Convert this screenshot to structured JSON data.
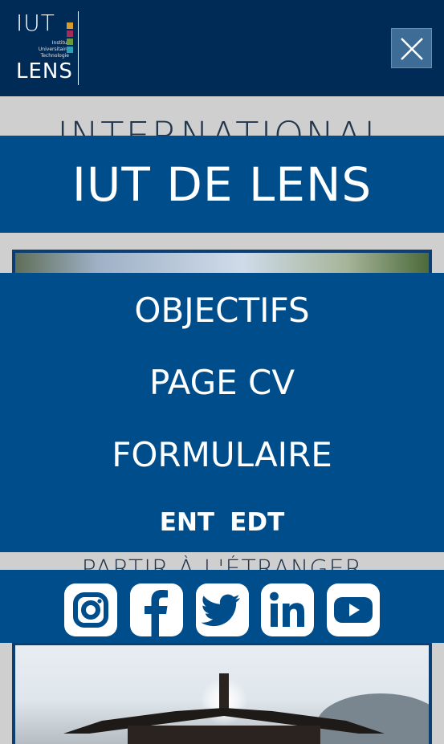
{
  "header": {
    "logo": {
      "top_text": "IUT",
      "bottom_text": "LENS",
      "subtitle_lines": [
        "Institut",
        "Universitaire",
        "Technologie"
      ],
      "square_colors": [
        "#d79d2c",
        "#a72a5a",
        "#6c9a3b",
        "#2a9fb6"
      ]
    },
    "close_icon": "close-icon"
  },
  "background": {
    "heading_top": "INTERNATIONAL",
    "heading_mid": "PARTIR À L'ÉTRANGER"
  },
  "menu": {
    "title": "IUT DE LENS",
    "items": [
      {
        "label": "OBJECTIFS"
      },
      {
        "label": "PAGE CV"
      },
      {
        "label": "FORMULAIRE"
      }
    ],
    "sub_links": [
      {
        "label": "ENT"
      },
      {
        "label": "EDT"
      }
    ]
  },
  "social": [
    {
      "icon": "instagram-icon"
    },
    {
      "icon": "facebook-icon"
    },
    {
      "icon": "twitter-icon"
    },
    {
      "icon": "linkedin-icon"
    },
    {
      "icon": "youtube-icon"
    }
  ],
  "colors": {
    "header_bg": "#002b57",
    "menu_bg": "#004d8c",
    "close_bg": "#3d6d96",
    "text": "#ffffff"
  }
}
